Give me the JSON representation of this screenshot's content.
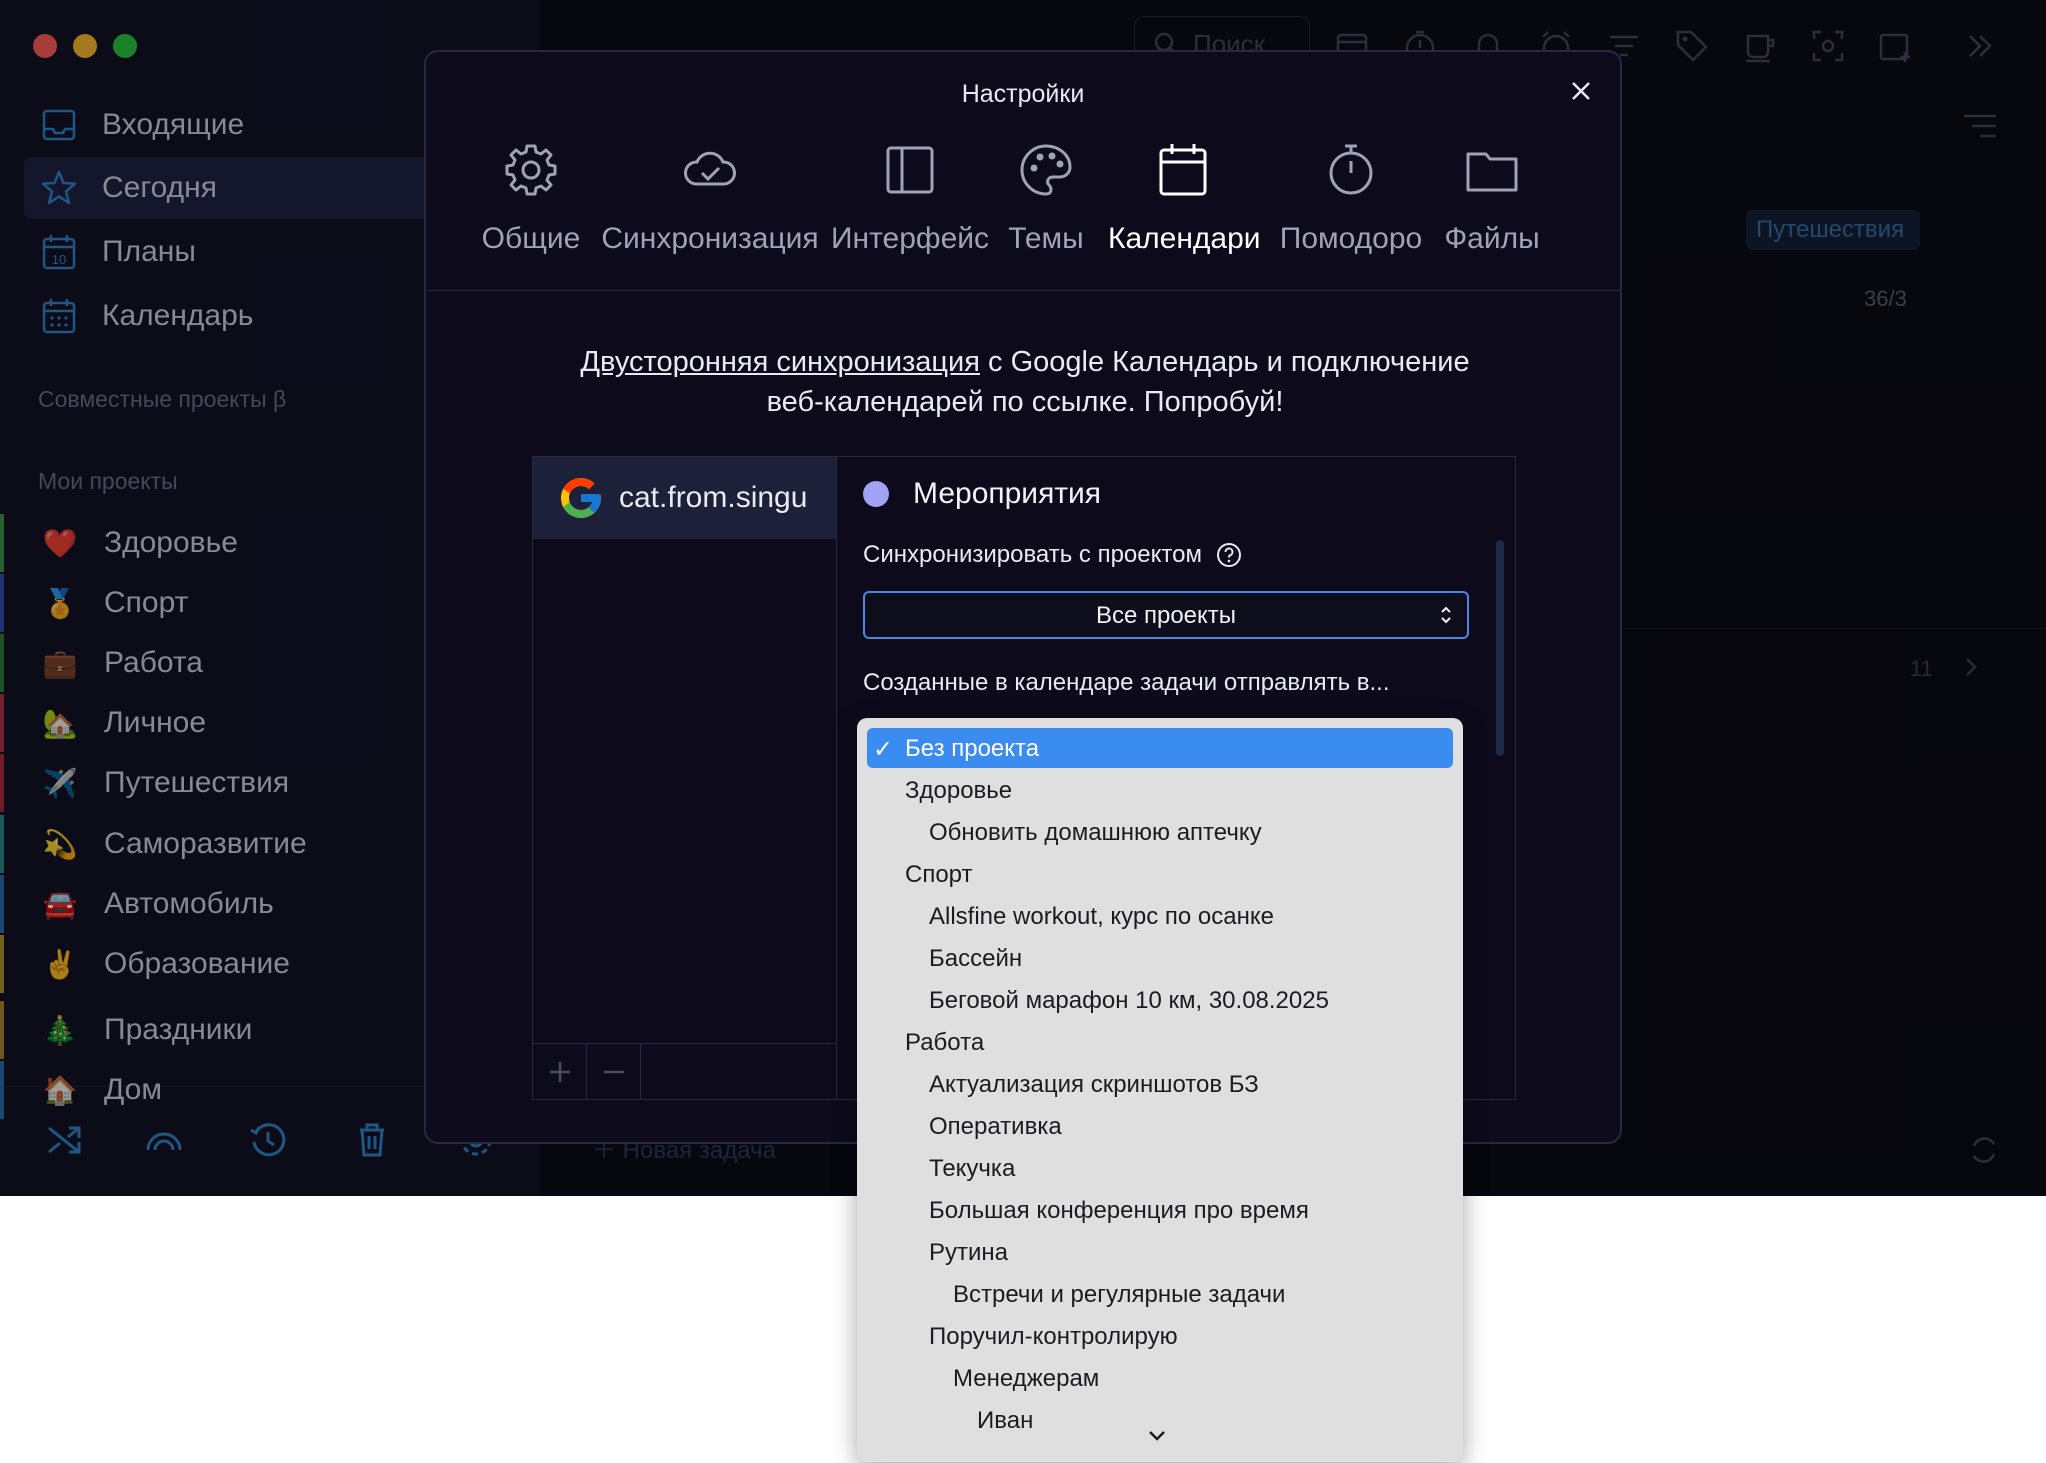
{
  "sidebar": {
    "nav": [
      {
        "label": "Входящие",
        "icon": "inbox-icon"
      },
      {
        "label": "Сегодня",
        "icon": "star-icon"
      },
      {
        "label": "Планы",
        "icon": "calendar-10-icon",
        "badge": "10"
      },
      {
        "label": "Календарь",
        "icon": "calendar-grid-icon"
      }
    ],
    "shared_title": "Совместные проекты β",
    "projects_title": "Мои проекты",
    "projects": [
      {
        "label": "Здоровье",
        "emoji": "❤️",
        "color": "#3a9a4a"
      },
      {
        "label": "Спорт",
        "emoji": "🏅",
        "color": "#3a4db0"
      },
      {
        "label": "Работа",
        "emoji": "💼",
        "color": "#2f7e3e"
      },
      {
        "label": "Личное",
        "emoji": "🏡",
        "color": "#b03050"
      },
      {
        "label": "Путешествия",
        "emoji": "✈️",
        "color": "#b02840"
      },
      {
        "label": "Саморазвитие",
        "emoji": "💫",
        "color": "#2d8a8a"
      },
      {
        "label": "Автомобиль",
        "emoji": "🚘",
        "color": "#2a6fb0"
      },
      {
        "label": "Образование",
        "emoji": "✌️",
        "color": "#b0952a"
      },
      {
        "label": "Праздники",
        "emoji": "🎄",
        "color": "#a8862a"
      },
      {
        "label": "Дом",
        "emoji": "🏠",
        "color": "#2a6fb0"
      }
    ]
  },
  "main": {
    "search_placeholder": "Поиск",
    "tag": "Путешествия",
    "count": "36/3",
    "number": "11",
    "new_task": "Новая задача"
  },
  "dialog": {
    "title": "Настройки",
    "tabs": [
      {
        "label": "Общие",
        "icon": "gear-icon"
      },
      {
        "label": "Синхронизация",
        "icon": "cloud-check-icon"
      },
      {
        "label": "Интерфейс",
        "icon": "sidebar-layout-icon"
      },
      {
        "label": "Темы",
        "icon": "palette-icon"
      },
      {
        "label": "Календари",
        "icon": "calendar-icon",
        "active": true
      },
      {
        "label": "Помодоро",
        "icon": "stopwatch-icon"
      },
      {
        "label": "Файлы",
        "icon": "folder-icon"
      }
    ],
    "promo_link": "Двусторонняя синхронизация",
    "promo_rest_1": " с Google Календарь и подключение",
    "promo_line_2": "веб-календарей по ссылке. Попробуй!",
    "account": "cat.from.singularity",
    "calendar_name": "Мероприятия",
    "calendar_color": "#a3a3f5",
    "sync_label": "Синхронизировать с проектом",
    "sync_value": "Все проекты",
    "send_label": "Созданные в календаре задачи отправлять в..."
  },
  "dropdown": {
    "items": [
      {
        "label": "Без проекта",
        "level": 0,
        "selected": true
      },
      {
        "label": "Здоровье",
        "level": 0
      },
      {
        "label": "Обновить домашнюю аптечку",
        "level": 1
      },
      {
        "label": "Спорт",
        "level": 0
      },
      {
        "label": "Allsfine workout, курс по осанке",
        "level": 1
      },
      {
        "label": "Бассейн",
        "level": 1
      },
      {
        "label": "Беговой марафон 10 км, 30.08.2025",
        "level": 1
      },
      {
        "label": "Работа",
        "level": 0
      },
      {
        "label": "Актуализация скриншотов БЗ",
        "level": 1
      },
      {
        "label": "Оперативка",
        "level": 1
      },
      {
        "label": "Текучка",
        "level": 1
      },
      {
        "label": "Большая конференция про время",
        "level": 1
      },
      {
        "label": "Рутина",
        "level": 1
      },
      {
        "label": "Встречи и регулярные задачи",
        "level": 2
      },
      {
        "label": "Поручил-контролирую",
        "level": 1
      },
      {
        "label": "Менеджерам",
        "level": 2
      },
      {
        "label": "Иван",
        "level": 3
      }
    ]
  }
}
